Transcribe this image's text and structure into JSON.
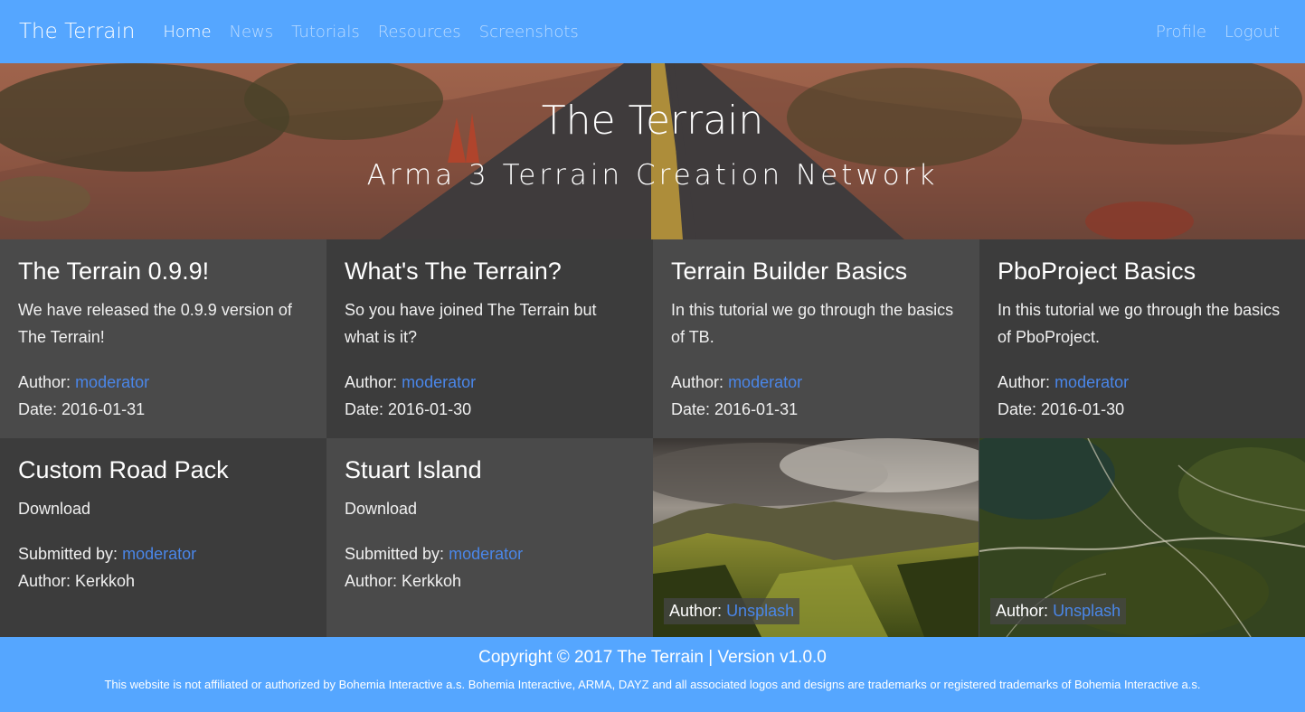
{
  "navbar": {
    "brand": "The Terrain",
    "links": [
      "Home",
      "News",
      "Tutorials",
      "Resources",
      "Screenshots"
    ],
    "right_links": [
      "Profile",
      "Logout"
    ],
    "color": "#55a6ff"
  },
  "hero": {
    "title": "The Terrain",
    "subtitle": "Arma 3 Terrain Creation Network"
  },
  "news": [
    {
      "title": "The Terrain 0.9.9!",
      "body": "We have released the 0.9.9 version of The Terrain!",
      "author_label": "Author:",
      "author": "moderator",
      "date": "Date: 2016-01-31"
    },
    {
      "title": "What's The Terrain?",
      "body": "So you have joined The Terrain but what is it?",
      "author_label": "Author:",
      "author": "moderator",
      "date": "Date: 2016-01-30"
    },
    {
      "title": "Terrain Builder Basics",
      "body": "In this tutorial we go through the basics of TB.",
      "author_label": "Author:",
      "author": "moderator",
      "date": "Date: 2016-01-31"
    },
    {
      "title": "PboProject Basics",
      "body": "In this tutorial we go through the basics of PboProject.",
      "author_label": "Author:",
      "author": "moderator",
      "date": "Date: 2016-01-30"
    }
  ],
  "resources": [
    {
      "title": "Custom Road Pack",
      "link": "Download",
      "submitted_label": "Submitted by:",
      "submitter": "moderator",
      "author": "Author: Kerkkoh"
    },
    {
      "title": "Stuart Island",
      "link": "Download",
      "submitted_label": "Submitted by:",
      "submitter": "moderator",
      "author": "Author: Kerkkoh"
    }
  ],
  "screenshots": [
    {
      "author_label": "Author:",
      "author": "Unsplash"
    },
    {
      "author_label": "Author:",
      "author": "Unsplash"
    }
  ],
  "footer": {
    "copyright": "Copyright © 2017 The Terrain | Version v1.0.0",
    "note": "This website is not affiliated or authorized by Bohemia Interactive a.s. Bohemia Interactive, ARMA, DAYZ and all associated logos and designs are trademarks or registered trademarks of Bohemia Interactive a.s."
  }
}
